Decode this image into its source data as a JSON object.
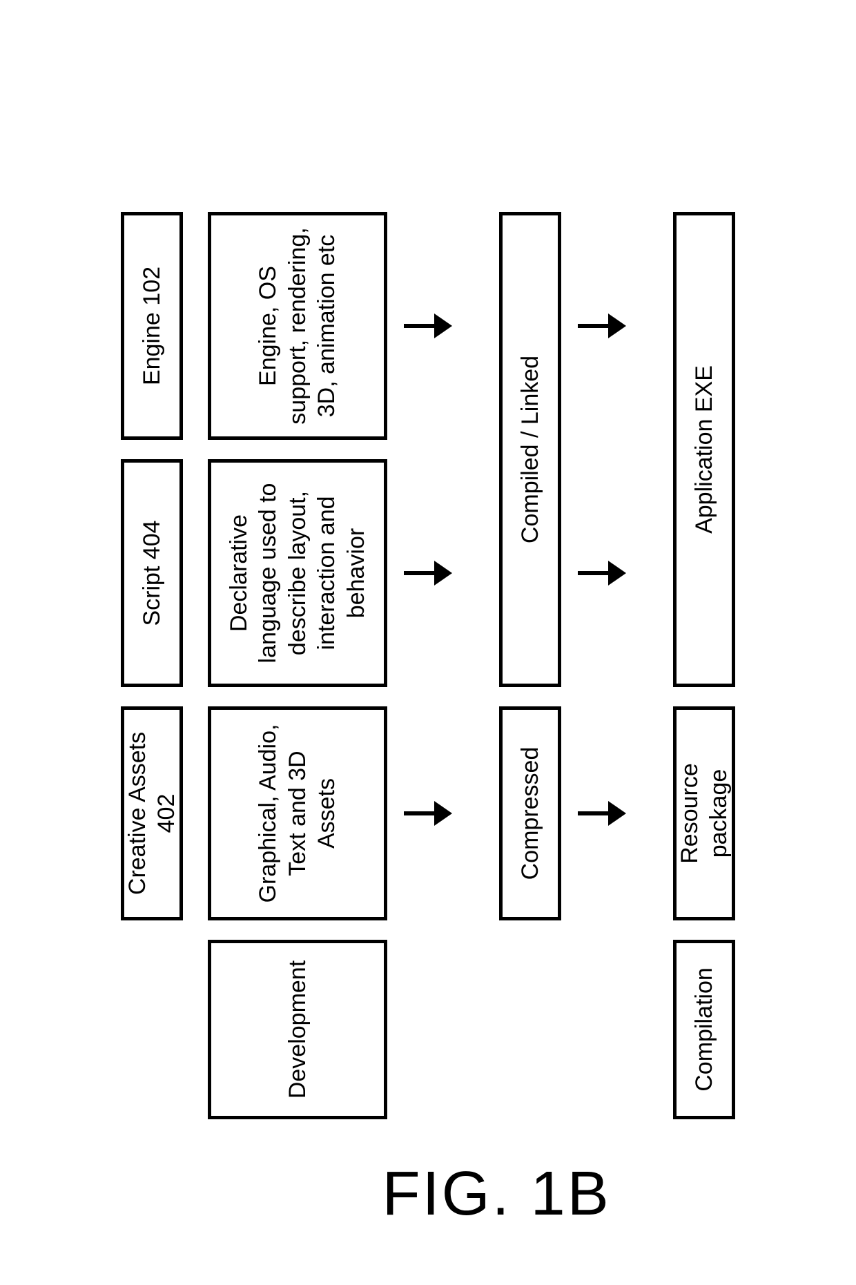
{
  "figure_label": "FIG. 1B",
  "stages": {
    "development": "Development",
    "compilation": "Compilation"
  },
  "headers": {
    "assets": "Creative Assets 402",
    "script": "Script 404",
    "engine": "Engine 102"
  },
  "desc": {
    "assets": "Graphical, Audio, Text and 3D Assets",
    "script": "Declarative language used to describe layout, interaction and behavior",
    "engine": "Engine, OS support, rendering, 3D, animation etc"
  },
  "process": {
    "compressed": "Compressed",
    "compiled": "Compiled / Linked"
  },
  "output": {
    "resource": "Resource package",
    "app": "Application EXE"
  }
}
